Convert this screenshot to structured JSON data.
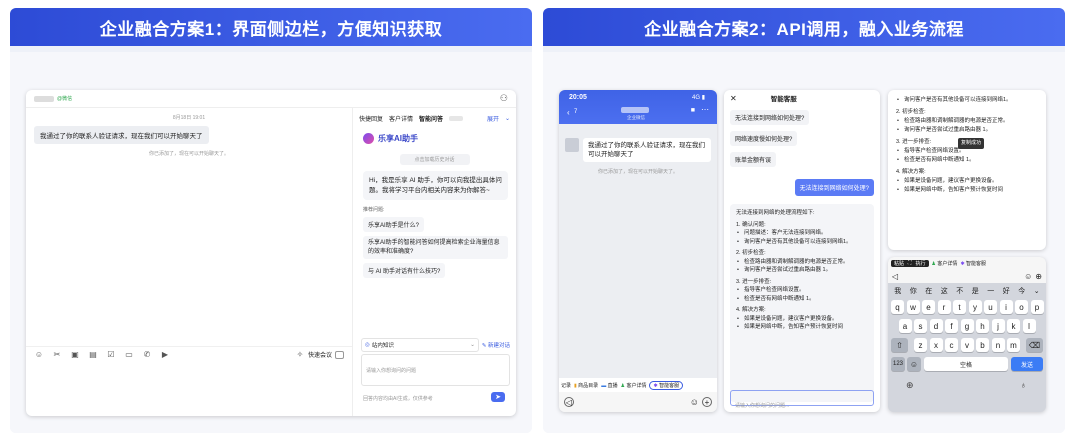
{
  "panel1": {
    "title": "企业融合方案1：界面侧边栏，方便知识获取",
    "app": {
      "contact_tag": "@微信",
      "timestamp": "8月18日 19:01",
      "left_message": "我通过了你的联系人验证请求，现在我们可以开始聊天了",
      "left_system_note": "你已添加了，现在可以开始聊天了。",
      "meeting_label": "快速会议",
      "side_tabs": [
        "快捷回复",
        "客户详情",
        "智能问答"
      ],
      "expand_label": "展开",
      "assistant_name": "乐享AI助手",
      "history_label": "点击加载历史对话",
      "greeting": "Hi，我是乐享 AI 助手，你可以向我提出具体问题。我将学习平台内相关内容来为你解答~",
      "suggest_label": "推荐问题:",
      "suggestions": [
        "乐享AI助手是什么?",
        "乐享AI助手的智能问答如何提高检索企业海量信息的效率和准确度?",
        "与 AI 助手对话有什么技巧?"
      ],
      "kb_label": "站内知识",
      "new_chat_label": "新建对话",
      "input_placeholder": "请输入你想询问的问题",
      "footer_note": "回答内容均由AI生成，仅供参考"
    }
  },
  "panel2": {
    "title": "企业融合方案2：API调用，融入业务流程",
    "phone": {
      "time": "20:05",
      "signal": "4G",
      "back_badge": "7",
      "sub_label": "企业微信",
      "message": "我通过了你的联系人验证请求，现在我们可以开始聊天了",
      "system_note": "你已添加了，现在可以开始聊天了。",
      "tools": [
        "记录",
        "商品目录",
        "直播",
        "客户详情",
        "智能客服"
      ]
    },
    "service": {
      "title": "智能客服",
      "chips": [
        "无法连接到网络如何处理?",
        "网络速度慢如何处理?",
        "账单金额有误"
      ],
      "user_question": "无法连接到网络如何处理?",
      "answer_intro": "无法连接到网络的处理流程如下:",
      "sections": [
        {
          "heading": "1. 确认问题:",
          "items": [
            "问题描述：客户无法连接到网络。",
            "询问客户是否有其他设备可以连接到网络1。"
          ]
        },
        {
          "heading": "2. 初步检查:",
          "items": [
            "检查路由器和调制解调器的电源是否正常。",
            "询问客户是否尝试过重启路由器 1。"
          ]
        },
        {
          "heading": "3. 进一步排查:",
          "items": [
            "指导客户检查网络设置。",
            "检查是否有网络中断通知 1。"
          ]
        },
        {
          "heading": "4. 解决方案:",
          "items": [
            "如果是设备问题，建议客户更换设备。",
            "如果是网络中断，告知客户预计恢复时间"
          ]
        }
      ],
      "input_placeholder": "请输入你想询问的问题..."
    },
    "zoom": {
      "top_item": "询问客户是否有其他设备可以连接到网络1。",
      "sections": [
        {
          "heading": "2. 初步检查:",
          "items": [
            "检查路由器和调制解调器的电源是否正常。",
            "询问客户是否尝试过重启路由器 1。"
          ]
        },
        {
          "heading": "3. 进一步排查:",
          "items": [
            "指导客户检查网络设置。",
            "检查是否有网络中断通知 1。"
          ]
        },
        {
          "heading": "4. 解决方案:",
          "items": [
            "如果是设备问题，建议客户更换设备。",
            "如果是网络中断，告知客户预计恢复时间"
          ]
        }
      ],
      "toast": "复制成功"
    },
    "keyboard": {
      "context_menu": [
        "粘贴",
        "执行"
      ],
      "tabs": [
        "客户详情",
        "智能客服"
      ],
      "candidates": [
        "我",
        "你",
        "在",
        "这",
        "不",
        "是",
        "一",
        "好",
        "今"
      ],
      "row1": [
        "q",
        "w",
        "e",
        "r",
        "t",
        "y",
        "u",
        "i",
        "o",
        "p"
      ],
      "row2": [
        "a",
        "s",
        "d",
        "f",
        "g",
        "h",
        "j",
        "k",
        "l"
      ],
      "row3": [
        "z",
        "x",
        "c",
        "v",
        "b",
        "n",
        "m"
      ],
      "num_key": "123",
      "space_key": "空格",
      "send_key": "发送"
    }
  }
}
